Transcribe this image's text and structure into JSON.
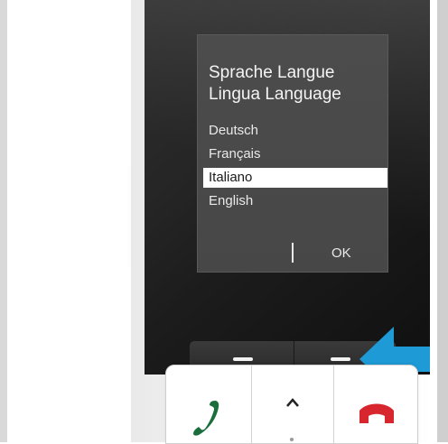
{
  "screen": {
    "title": "Sprache Langue Lingua Language",
    "languages": [
      {
        "label": "Deutsch",
        "selected": false
      },
      {
        "label": "Français",
        "selected": false
      },
      {
        "label": "Italiano",
        "selected": true
      },
      {
        "label": "English",
        "selected": false
      }
    ],
    "right_softkey_label": "OK"
  },
  "softkeys": {
    "left_icon": "dash-icon",
    "right_icon": "dash-icon"
  },
  "keypad": {
    "call_icon": "phone-handset-icon",
    "nav_icon": "chevron-up-icon",
    "end_icon": "hang-up-icon"
  },
  "colors": {
    "screen_background": "#4a4a4a",
    "selection_highlight": "#ffffff",
    "call_green": "#1a6e3c",
    "end_red": "#d8262e",
    "indicator_arrow": "#1e9ad6"
  }
}
